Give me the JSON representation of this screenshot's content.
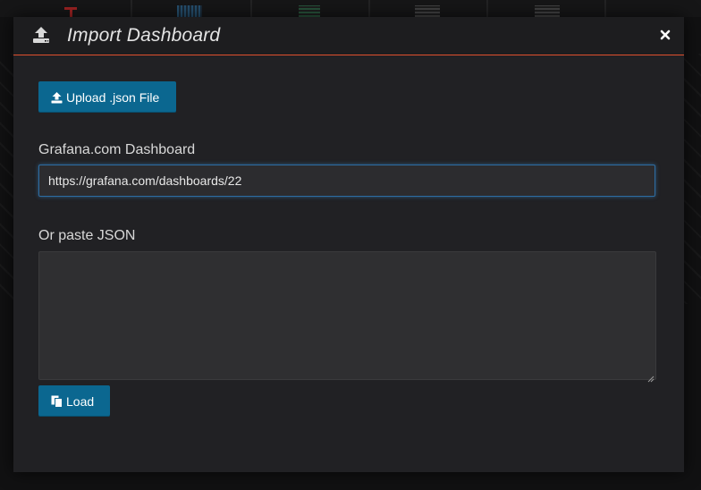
{
  "dialog": {
    "title": "Import Dashboard",
    "upload_button_label": "Upload .json File",
    "grafana_com_label": "Grafana.com Dashboard",
    "grafana_com_url": "https://grafana.com/dashboards/22",
    "paste_json_label": "Or paste JSON",
    "paste_json_value": "",
    "load_button_label": "Load"
  },
  "icons": {
    "header": "import-icon",
    "upload": "upload-icon",
    "load": "copy-icon",
    "close": "close-icon"
  },
  "colors": {
    "primary_button": "#0b6790",
    "header_accent": "#e0502d",
    "input_focus": "#2d6da3",
    "modal_background": "#212124"
  }
}
